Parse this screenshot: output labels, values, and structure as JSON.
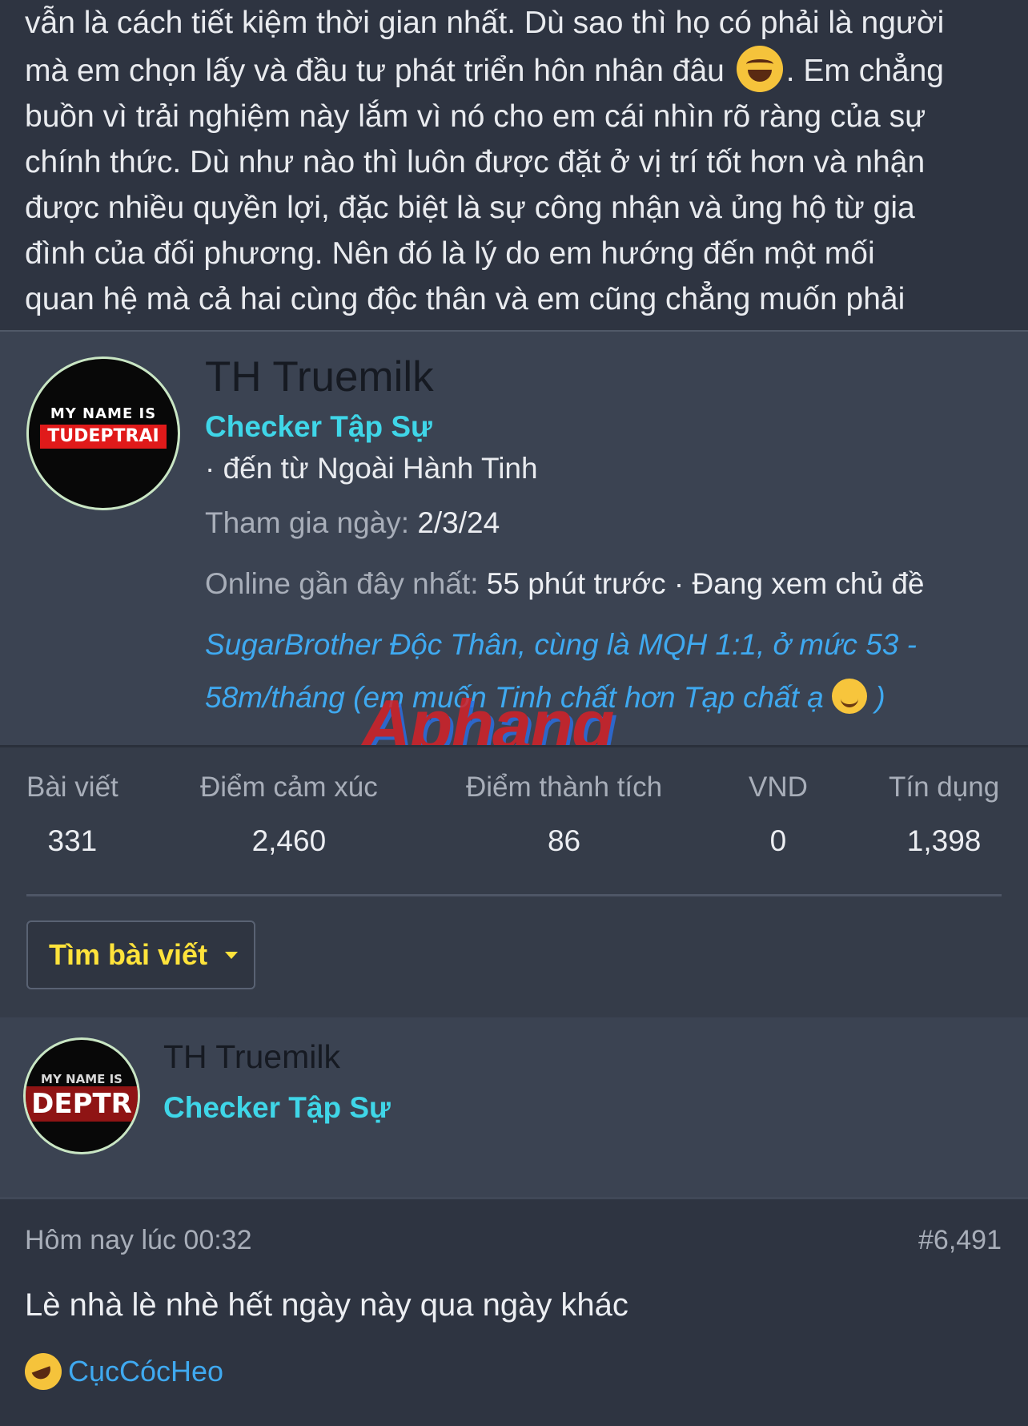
{
  "article": {
    "lines": [
      "vẫn là cách tiết kiệm thời gian nhất. Dù sao thì họ có phải là người",
      "mà em chọn lấy và đầu tư phát triển hôn nhân đâu",
      ". Em chẳng",
      "buồn vì trải nghiệm này lắm vì nó cho em cái nhìn rõ ràng của sự",
      "chính thức. Dù như nào thì luôn được đặt ở vị trí tốt hơn và nhận",
      "được nhiều quyền lợi, đặc biệt là sự công nhận và ủng hộ từ gia",
      "đình của đối phương. Nên đó là lý do em hướng đến một mối",
      "quan hệ mà cả hai cùng độc thân và em cũng chẳng muốn phải"
    ],
    "emoji": "laughing-tears-icon"
  },
  "member_card": {
    "avatar_text_top": "MY NAME IS",
    "avatar_text_plate": "TUDEPTRAI",
    "username": "TH Truemilk",
    "rank": "Checker Tập Sự",
    "origin": "· đến từ Ngoài Hành Tinh",
    "joined_label": "Tham gia ngày:",
    "joined_value": "2/3/24",
    "online_label": "Online gần đây nhất:",
    "online_value": "55 phút trước · Đang xem chủ đề",
    "thread_title_1": "SugarBrother Độc Thân, cùng là MQH 1:1, ở mức 53 -",
    "thread_title_2": "58m/tháng (em muốn Tinh chất hơn Tạp chất ạ",
    "thread_title_end": ")",
    "watermark": "Aphang",
    "stats": [
      {
        "label": "Bài viết",
        "value": "331"
      },
      {
        "label": "Điểm cảm xúc",
        "value": "2,460"
      },
      {
        "label": "Điểm thành tích",
        "value": "86"
      },
      {
        "label": "VND",
        "value": "0"
      },
      {
        "label": "Tín dụng",
        "value": "1,398"
      }
    ],
    "find_posts_label": "Tìm bài viết"
  },
  "author": {
    "avatar_text_top": "MY NAME IS",
    "avatar_text_plate": "DEPTR",
    "username": "TH Truemilk",
    "rank": "Checker Tập Sự"
  },
  "post": {
    "time": "Hôm nay lúc 00:32",
    "number": "#6,491",
    "body": "Lè nhà lè nhè hết ngày này qua ngày khác",
    "reaction_user": "CụcCócHeo",
    "reaction_icon": "rofl-emoji-icon"
  },
  "colors": {
    "background": "#2e3441",
    "card": "#3b4352",
    "rank": "#3fd6e8",
    "link": "#3fa9f0",
    "button_text": "#ffe33b"
  }
}
